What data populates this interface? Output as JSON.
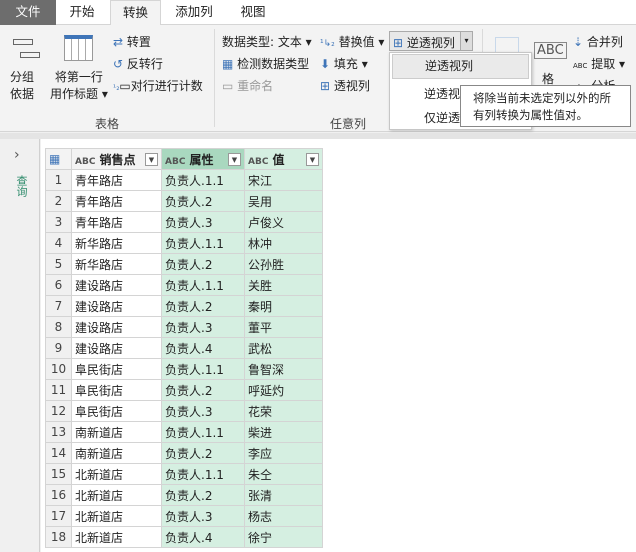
{
  "tabs": [
    "文件",
    "开始",
    "转换",
    "添加列",
    "视图"
  ],
  "ribbon": {
    "group_by": [
      "分组",
      "依据"
    ],
    "first_row": [
      "将第一行",
      "用作标题"
    ],
    "transpose": "转置",
    "reverse_rows": "反转行",
    "count_rows": "对行进行计数",
    "table_group": "表格",
    "data_type": "数据类型: 文本",
    "detect_type": "检测数据类型",
    "rename": "重命名",
    "replace_values": "替换值",
    "fill": "填充",
    "pivot": "透视列",
    "unpivot": "逆透视列",
    "any_column_group": "任意列",
    "format": "格",
    "merge_columns": "合并列",
    "extract": "提取",
    "parse": "分析"
  },
  "menu": {
    "items": [
      "逆透视列",
      "逆透视",
      "仅逆透"
    ]
  },
  "tooltip": "将除当前未选定列以外的所有列转换为属性值对。",
  "sidebar": {
    "label": "查询"
  },
  "table": {
    "headers": [
      "销售点",
      "属性",
      "值"
    ],
    "rows": [
      [
        "青年路店",
        "负责人.1.1",
        "宋江"
      ],
      [
        "青年路店",
        "负责人.2",
        "吴用"
      ],
      [
        "青年路店",
        "负责人.3",
        "卢俊义"
      ],
      [
        "新华路店",
        "负责人.1.1",
        "林冲"
      ],
      [
        "新华路店",
        "负责人.2",
        "公孙胜"
      ],
      [
        "建设路店",
        "负责人.1.1",
        "关胜"
      ],
      [
        "建设路店",
        "负责人.2",
        "秦明"
      ],
      [
        "建设路店",
        "负责人.3",
        "董平"
      ],
      [
        "建设路店",
        "负责人.4",
        "武松"
      ],
      [
        "阜民街店",
        "负责人.1.1",
        "鲁智深"
      ],
      [
        "阜民街店",
        "负责人.2",
        "呼延灼"
      ],
      [
        "阜民街店",
        "负责人.3",
        "花荣"
      ],
      [
        "南新道店",
        "负责人.1.1",
        "柴进"
      ],
      [
        "南新道店",
        "负责人.2",
        "李应"
      ],
      [
        "北新道店",
        "负责人.1.1",
        "朱仝"
      ],
      [
        "北新道店",
        "负责人.2",
        "张清"
      ],
      [
        "北新道店",
        "负责人.3",
        "杨志"
      ],
      [
        "北新道店",
        "负责人.4",
        "徐宁"
      ]
    ]
  }
}
